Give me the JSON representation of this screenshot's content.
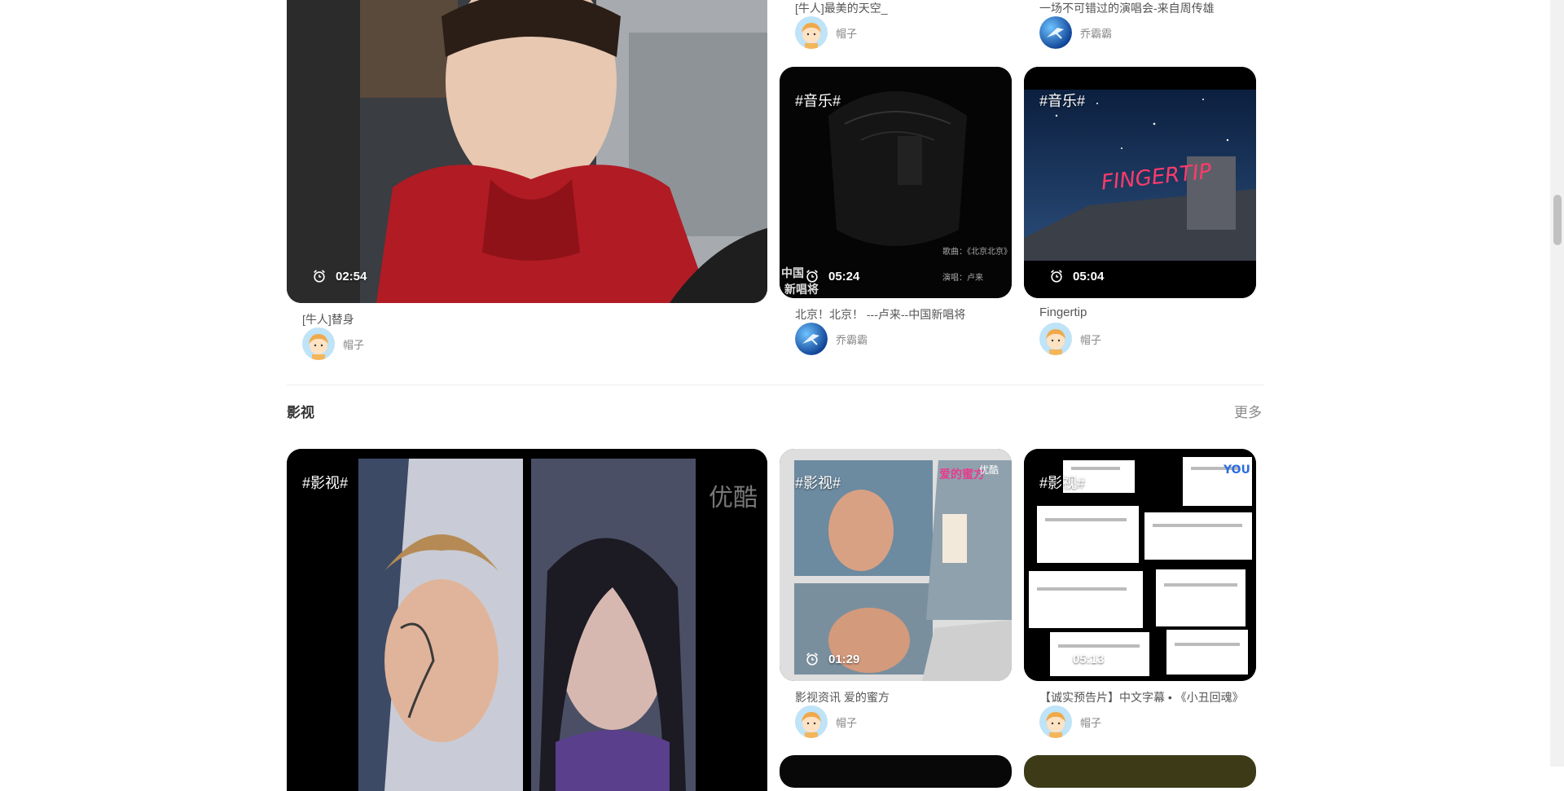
{
  "top_row": {
    "cards": [
      {
        "title": "[牛人]最美的天空_",
        "author": "帽子"
      },
      {
        "title": "一场不可错过的演唱会-来自周传雄",
        "author": "乔霸霸"
      }
    ]
  },
  "music_section": {
    "large": {
      "title": "[牛人]替身",
      "author": "帽子",
      "duration": "02:54"
    },
    "cards": [
      {
        "tag": "#音乐#",
        "duration": "05:24",
        "title": "北京！北京！ ---卢来--中国新唱将",
        "author": "乔霸霸"
      },
      {
        "tag": "#音乐#",
        "duration": "05:04",
        "title": "Fingertip",
        "author": "帽子"
      }
    ]
  },
  "film_section": {
    "title": "影视",
    "more": "更多",
    "large": {
      "tag": "#影视#"
    },
    "cards": [
      {
        "tag": "#影视#",
        "duration": "01:29",
        "title": "影视资讯 爱的蜜方",
        "author": "帽子"
      },
      {
        "tag": "#影视#",
        "duration": "05:13",
        "title": "【诚实预告片】中文字幕 • 《小丑回魂》",
        "author": "帽子"
      }
    ]
  },
  "icons": {
    "duration": "alarm-clock-icon",
    "avatar_maozi": "cartoon-child-avatar",
    "avatar_qiaobaba": "blue-planet-avatar"
  },
  "colors": {
    "background": "#ffffff",
    "text_title": "#555555",
    "text_author": "#888888",
    "section_title": "#333333"
  }
}
